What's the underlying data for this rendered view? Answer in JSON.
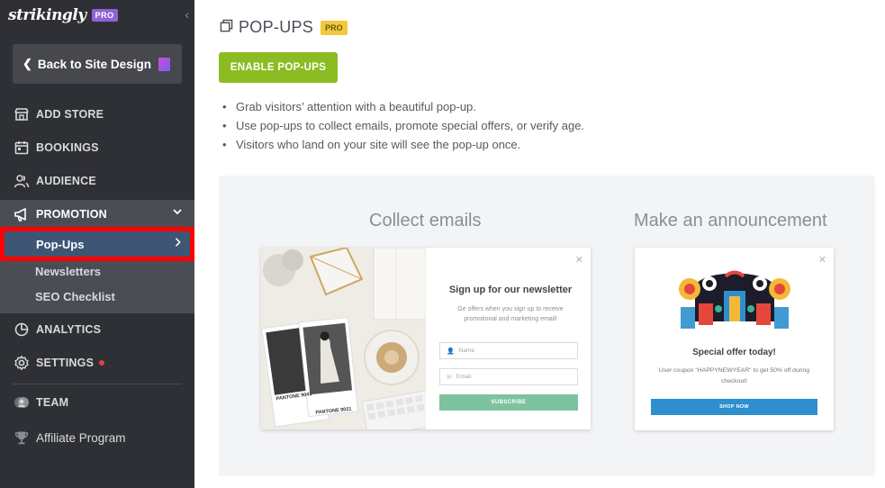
{
  "sidebar": {
    "logo": "strikingly",
    "plan_badge": "PRO",
    "collapse_glyph": "‹",
    "back_button": "Back to Site Design",
    "nav": [
      {
        "label": "ADD STORE",
        "icon": "store-icon"
      },
      {
        "label": "BOOKINGS",
        "icon": "calendar-icon"
      },
      {
        "label": "AUDIENCE",
        "icon": "audience-icon"
      },
      {
        "label": "PROMOTION",
        "icon": "megaphone-icon"
      },
      {
        "label": "ANALYTICS",
        "icon": "analytics-icon"
      },
      {
        "label": "SETTINGS",
        "icon": "gear-icon"
      },
      {
        "label": "TEAM",
        "icon": "team-icon"
      },
      {
        "label": "Affiliate Program",
        "icon": "trophy-icon"
      }
    ],
    "promotion_sub": [
      "Pop-Ups",
      "Newsletters",
      "SEO Checklist"
    ]
  },
  "main": {
    "title": "POP-UPS",
    "title_badge": "PRO",
    "enable_button": "ENABLE POP-UPS",
    "bullets": [
      "Grab visitors’ attention with a beautiful pop-up.",
      "Use pop-ups to collect emails, promote special offers, or verify age.",
      "Visitors who land on your site will see the pop-up once."
    ],
    "examples": {
      "collect": {
        "title": "Collect emails",
        "heading": "Sign up for our newsletter",
        "subtext": "Ge offers when you sign up to receive promotional and marketing email!",
        "name_placeholder": "Name",
        "email_placeholder": "Email",
        "button": "SUBSCRIBE",
        "photo_text_1": "PANTONE 9041",
        "photo_text_2": "PANTONE 9021"
      },
      "announce": {
        "title": "Make an announcement",
        "heading": "Special offer today!",
        "subtext": "User coupon \"HAPPYNEWYEAR\" to get 50% off during checkout!",
        "button": "SHOP NOW"
      }
    }
  },
  "colors": {
    "sidebar_bg": "#2f3035",
    "accent_green": "#8bbc22",
    "active_highlight": "#ff0000",
    "subscribe_green": "#7ec3a0",
    "shop_blue": "#2d8fce"
  }
}
